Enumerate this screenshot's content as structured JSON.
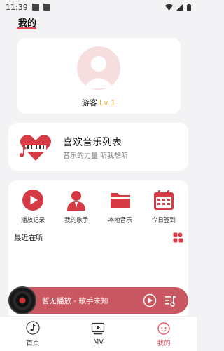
{
  "status_bar": {
    "time": "11:39"
  },
  "header": {
    "title": "我的"
  },
  "profile": {
    "name": "游客",
    "level": "Lv 1"
  },
  "favorites": {
    "title": "喜欢音乐列表",
    "subtitle": "音乐的力量 听我想听"
  },
  "quick_actions": [
    {
      "label": "播放记录",
      "icon": "play-circle-icon"
    },
    {
      "label": "我的歌手",
      "icon": "singer-icon"
    },
    {
      "label": "本地音乐",
      "icon": "folder-icon"
    },
    {
      "label": "今日签到",
      "icon": "calendar-icon"
    }
  ],
  "recent": {
    "title": "最近在听"
  },
  "player": {
    "now_playing": "暂无播放 - 歌手未知"
  },
  "bottom_nav": [
    {
      "label": "首页",
      "icon": "music-note-icon",
      "active": false
    },
    {
      "label": "MV",
      "icon": "mv-play-icon",
      "active": false
    },
    {
      "label": "我的",
      "icon": "smile-face-icon",
      "active": true
    }
  ],
  "colors": {
    "accent": "#e3485a",
    "player_bg": "#c95761",
    "level": "#f0b030",
    "page_bg": "#f3f3f5"
  }
}
